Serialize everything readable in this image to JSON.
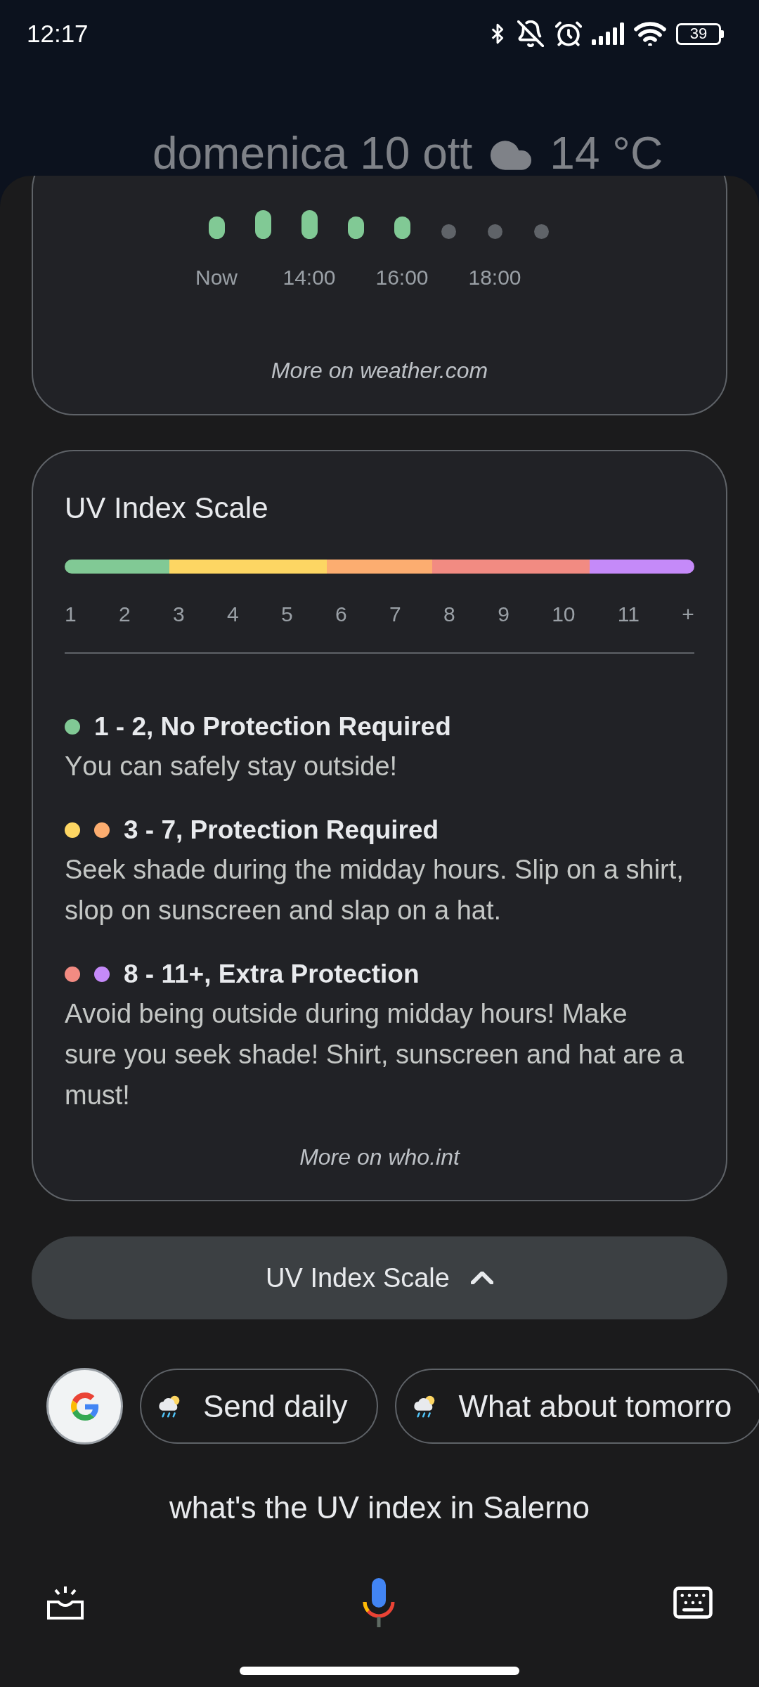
{
  "status_bar": {
    "time": "12:17",
    "battery": "39"
  },
  "header": {
    "date": "domenica 10 ott",
    "temperature": "14 °C"
  },
  "hourly_card": {
    "slots": [
      {
        "kind": "short",
        "label": "Now"
      },
      {
        "kind": "tall"
      },
      {
        "kind": "tall",
        "label": "14:00"
      },
      {
        "kind": "short"
      },
      {
        "kind": "short",
        "label": "16:00"
      },
      {
        "kind": "dot"
      },
      {
        "kind": "dot",
        "label": "18:00"
      },
      {
        "kind": "dot"
      }
    ],
    "link": "More on weather.com"
  },
  "uv_card": {
    "title": "UV Index Scale",
    "segments": [
      {
        "color": "#81c995",
        "ticks": [
          "1",
          "2"
        ]
      },
      {
        "color": "#fdd663",
        "ticks": [
          "3",
          "4",
          "5"
        ]
      },
      {
        "color": "#fcad70",
        "ticks": [
          "6",
          "7"
        ]
      },
      {
        "color": "#f28b82",
        "ticks": [
          "8",
          "9",
          "10"
        ]
      },
      {
        "color": "#c58af9",
        "ticks": [
          "11",
          "+"
        ]
      }
    ],
    "legend": [
      {
        "dots": [
          {
            "color": "#81c995"
          }
        ],
        "title": "1 - 2, No Protection Required",
        "description": "You can safely stay outside!"
      },
      {
        "dots": [
          {
            "color": "#fdd663"
          },
          {
            "color": "#fcad70"
          }
        ],
        "title": "3 - 7, Protection Required",
        "description": "Seek shade during the midday hours. Slip on a shirt, slop on sunscreen and slap on a hat."
      },
      {
        "dots": [
          {
            "color": "#f28b82"
          },
          {
            "color": "#c58af9"
          }
        ],
        "title": "8 - 11+, Extra Protection",
        "description": "Avoid being outside during midday hours! Make sure you seek shade! Shirt, sunscreen and hat are a must!"
      }
    ],
    "link": "More on who.int"
  },
  "toggle_button": {
    "label": "UV Index Scale",
    "expanded": true
  },
  "suggestions": [
    {
      "label": "Send daily"
    },
    {
      "label": "What about tomorro"
    }
  ],
  "query": "what's the UV index in Salerno"
}
